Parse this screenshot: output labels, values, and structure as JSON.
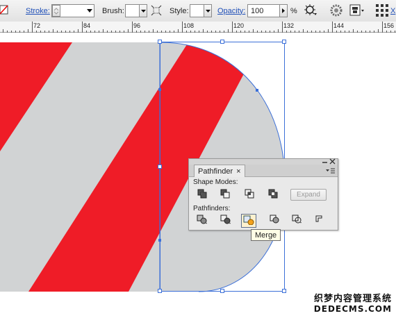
{
  "control_bar": {
    "stroke_label": "Stroke:",
    "brush_label": "Brush:",
    "style_label": "Style:",
    "opacity_label": "Opacity:",
    "opacity_value": "100",
    "percent_sign": "%",
    "edge_label": "X"
  },
  "ruler": {
    "ticks": [
      "72",
      "84",
      "96",
      "108",
      "120",
      "132",
      "144",
      "156"
    ]
  },
  "pathfinder": {
    "tab_label": "Pathfinder",
    "tab_close": "×",
    "shape_modes_label": "Shape Modes:",
    "expand_label": "Expand",
    "pathfinders_label": "Pathfinders:",
    "tooltip": "Merge",
    "shape_mode_icons": [
      "unite-icon",
      "minus-front-icon",
      "intersect-icon",
      "exclude-icon"
    ],
    "pathfinder_icons": [
      "divide-icon",
      "trim-icon",
      "merge-icon",
      "crop-icon",
      "outline-icon",
      "minus-back-icon"
    ]
  },
  "watermark": {
    "line1": "织梦内容管理系统",
    "line2": "DEDECMS.COM"
  },
  "colors": {
    "stripe_red": "#ef1c27",
    "shape_gray": "#d1d3d4",
    "selection_blue": "#3b6fd8"
  }
}
